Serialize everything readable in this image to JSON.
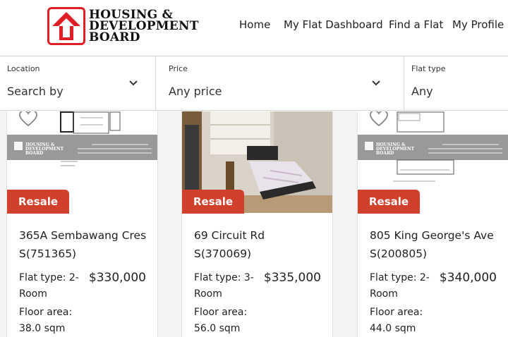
{
  "header": {
    "logo_alt": "HOUSING & DEVELOPMENT BOARD",
    "logo_lines": [
      "HOUSING &",
      "DEVELOPMENT",
      "BOARD"
    ],
    "nav": [
      "Home",
      "My Flat Dashboard",
      "Find a Flat",
      "My Profile"
    ]
  },
  "filters": {
    "location": {
      "label": "Location",
      "value": "Search by"
    },
    "price": {
      "label": "Price",
      "value": "Any price"
    },
    "flat_type": {
      "label": "Flat type",
      "value": "Any"
    }
  },
  "listings": [
    {
      "badge": "Resale",
      "address": "365A Sembawang Cres",
      "postal": "S(751365)",
      "flat_type": "Flat type: 2-Room",
      "price": "$330,000",
      "floor_area_label": "Floor area:",
      "floor_area": "38.0 sqm",
      "image": "floorplan"
    },
    {
      "badge": "Resale",
      "address": "69 Circuit Rd",
      "postal": "S(370069)",
      "flat_type": "Flat type: 3-Room",
      "price": "$335,000",
      "floor_area_label": "Floor area:",
      "floor_area": "56.0 sqm",
      "image": "bedroom-photo"
    },
    {
      "badge": "Resale",
      "address": "805 King George's Ave",
      "postal": "S(200805)",
      "flat_type": "Flat type: 2-Room",
      "price": "$340,000",
      "floor_area_label": "Floor area:",
      "floor_area": "44.0 sqm",
      "image": "floorplan"
    }
  ],
  "colors": {
    "brand_red": "#e01e26",
    "badge_red": "#d0402a"
  }
}
